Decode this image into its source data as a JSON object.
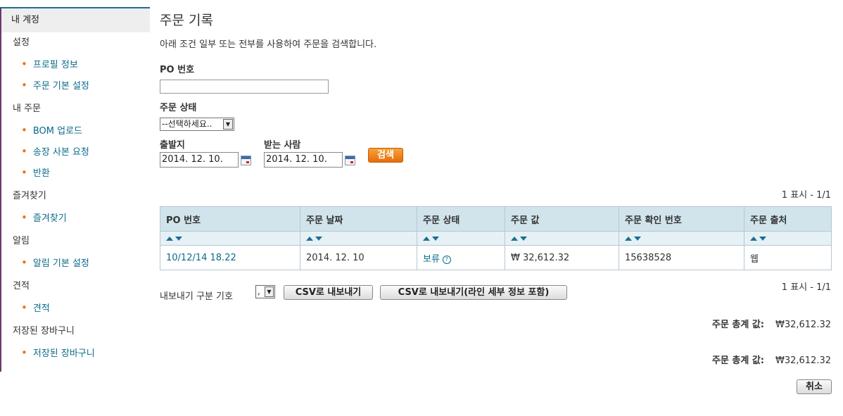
{
  "sidebar": {
    "header": "내 계정",
    "sections": [
      {
        "title": "설정",
        "items": [
          "프로필 정보",
          "주문 기본 설정"
        ]
      },
      {
        "title": "내 주문",
        "items": [
          "BOM 업로드",
          "송장 사본 요청",
          "반환"
        ]
      },
      {
        "title": "즐겨찾기",
        "items": [
          "즐겨찾기"
        ]
      },
      {
        "title": "알림",
        "items": [
          "알림 기본 설정"
        ]
      },
      {
        "title": "견적",
        "items": [
          "견적"
        ]
      },
      {
        "title": "저장된 장바구니",
        "items": [
          "저장된 장바구니"
        ]
      }
    ]
  },
  "main": {
    "title": "주문 기록",
    "description": "아래 조건 일부 또는 전부를 사용하여 주문을 검색합니다.",
    "po_label": "PO 번호",
    "po_value": "",
    "status_label": "주문 상태",
    "status_selected": "--선택하세요..",
    "from_label": "출발지",
    "from_value": "2014. 12. 10.",
    "to_label": "받는 사람",
    "to_value": "2014. 12. 10.",
    "search_label": "검색",
    "count_top": "1 표시 - 1/1",
    "count_bottom": "1 표시 - 1/1",
    "table": {
      "headers": [
        "PO 번호",
        "주문 날짜",
        "주문 상태",
        "주문 값",
        "주문 확인 번호",
        "주문 출처"
      ],
      "rows": [
        {
          "po": "10/12/14 18.22",
          "date": "2014. 12. 10",
          "status": "보류",
          "value": "₩ 32,612.32",
          "confirm": "15638528",
          "source": "웹"
        }
      ]
    },
    "export_label": "내보내기 구분 기호",
    "export_delim": ",",
    "csv_label": "CSV로 내보내기",
    "csv_detail_label": "CSV로 내보내기(라인 세부 정보 포함)",
    "total_label": "주문 총계 값:",
    "total_value": "₩32,612.32",
    "cancel_label": "취소"
  }
}
